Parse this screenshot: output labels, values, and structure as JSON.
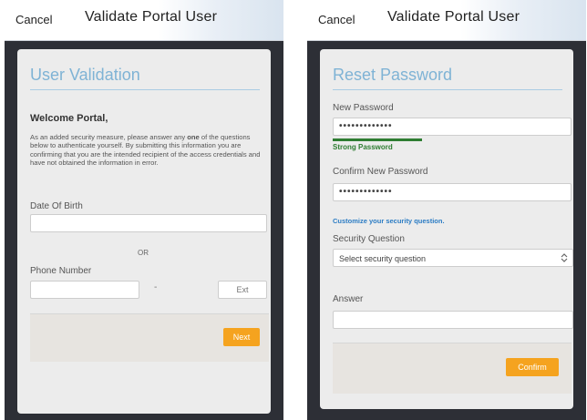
{
  "left_screen": {
    "topbar": {
      "cancel_label": "Cancel",
      "title": "Validate Portal User"
    },
    "card": {
      "title": "User Validation",
      "welcome": "Welcome Portal,",
      "paragraph_before": "As an added security measure, please answer any ",
      "paragraph_bold": "one",
      "paragraph_after": " of the questions below to authenticate yourself. By submitting this information you are confirming that you are the intended recipient of the access credentials and have not obtained the information in error.",
      "dob_label": "Date Of Birth",
      "dob_value": "",
      "or_label": "OR",
      "phone_label": "Phone Number",
      "phone_value": "",
      "ext_placeholder": "Ext",
      "next_label": "Next"
    }
  },
  "right_screen": {
    "topbar": {
      "cancel_label": "Cancel",
      "title": "Validate Portal User"
    },
    "card": {
      "title": "Reset Password",
      "new_password_label": "New Password",
      "new_password_value": "•••••••••••••",
      "strength_text": "Strong Password",
      "strength_level": 0.35,
      "strength_color": "#2e7d32",
      "confirm_label": "Confirm New Password",
      "confirm_value": "•••••••••••••",
      "customize_link": "Customize your security question.",
      "security_question_label": "Security Question",
      "security_question_selected": "Select security question",
      "answer_label": "Answer",
      "answer_value": "",
      "confirm_button": "Confirm"
    }
  },
  "colors": {
    "accent_button": "#f5a31f",
    "title_blue": "#7fb3d5",
    "link_blue": "#2b7cc4",
    "dark_frame": "#2d2f36"
  }
}
